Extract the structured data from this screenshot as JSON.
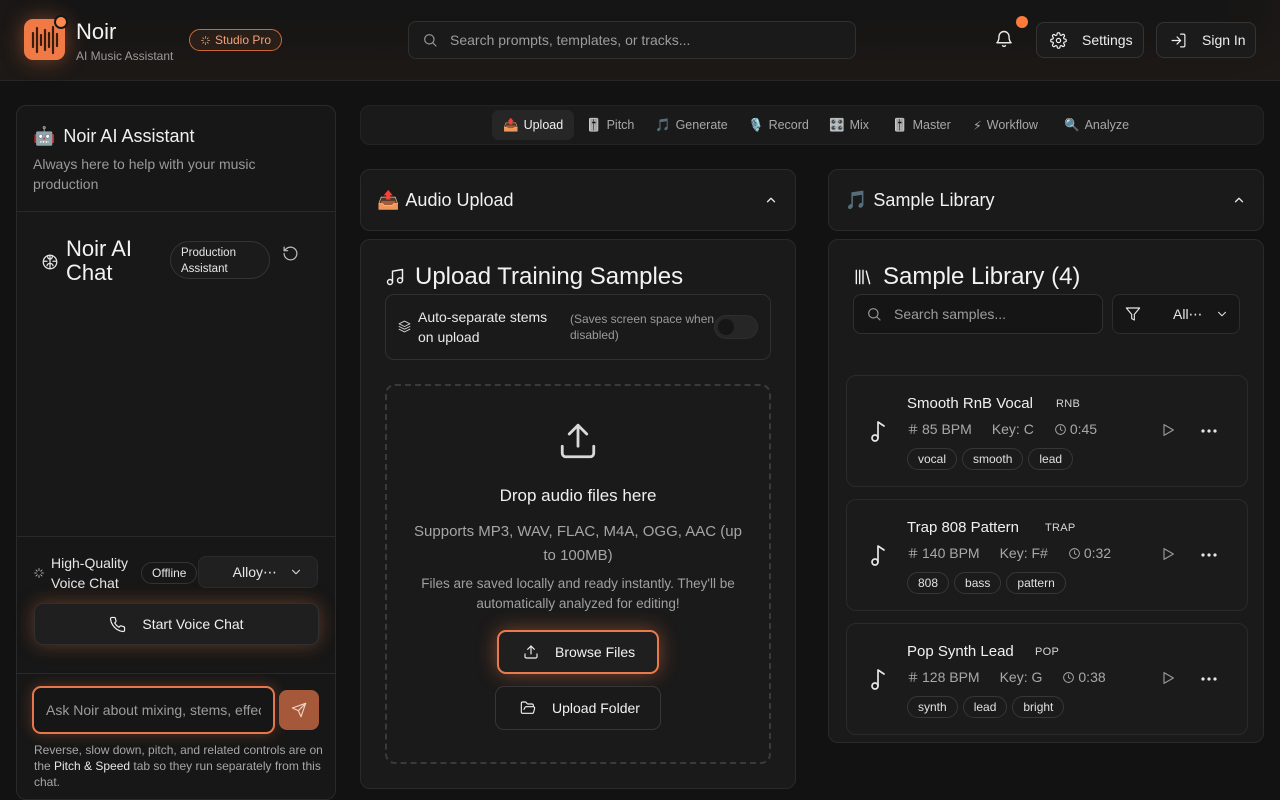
{
  "header": {
    "brand_name": "Noir",
    "brand_sub": "AI Music Assistant",
    "studio_badge": "Studio Pro",
    "search_placeholder": "Search prompts, templates, or tracks...",
    "settings_label": "Settings",
    "signin_label": "Sign In"
  },
  "sidebar": {
    "assistant_title": "Noir AI Assistant",
    "assistant_subtitle": "Always here to help with your music production",
    "chat_title": "Noir AI Chat",
    "production_badge": "Production Assistant",
    "voice": {
      "label": "High-Quality Voice Chat",
      "status": "Offline",
      "selected_voice": "Alloy⋯",
      "start_label": "Start Voice Chat"
    },
    "input_placeholder": "Ask Noir about mixing, stems, effects...",
    "hint_pre": "Reverse, slow down, pitch, and related controls are on the ",
    "hint_bold": "Pitch & Speed",
    "hint_post": " tab so they run separately from this chat."
  },
  "tabs": [
    {
      "emoji": "📤",
      "label": "Upload",
      "active": true
    },
    {
      "emoji": "🎚️",
      "label": "Pitch"
    },
    {
      "emoji": "🎵",
      "label": "Generate"
    },
    {
      "emoji": "🎙️",
      "label": "Record"
    },
    {
      "emoji": "🎛️",
      "label": "Mix"
    },
    {
      "emoji": "🎚️",
      "label": "Master"
    },
    {
      "emoji": "⚡",
      "label": "Workflow"
    },
    {
      "emoji": "🔍",
      "label": "Analyze"
    }
  ],
  "upload": {
    "section_emoji": "📤",
    "section_title": "Audio Upload",
    "card_title": "Upload Training Samples",
    "auto_sep_label": "Auto-separate stems on upload",
    "auto_sep_note": "(Saves screen space when disabled)",
    "drop_title": "Drop audio files here",
    "drop_formats": "Supports MP3, WAV, FLAC, M4A, OGG, AAC (up to 100MB)",
    "drop_note": "Files are saved locally and ready instantly. They'll be automatically analyzed for editing!",
    "browse_label": "Browse Files",
    "folder_label": "Upload Folder"
  },
  "library": {
    "section_emoji": "🎵",
    "section_title": "Sample Library",
    "card_title": "Sample Library (4)",
    "search_placeholder": "Search samples...",
    "filter_value": "All⋯",
    "samples": [
      {
        "name": "Smooth RnB Vocal",
        "genre": "RNB",
        "bpm": "85 BPM",
        "key": "Key: C",
        "duration": "0:45",
        "tags": [
          "vocal",
          "smooth",
          "lead"
        ]
      },
      {
        "name": "Trap 808 Pattern",
        "genre": "TRAP",
        "bpm": "140 BPM",
        "key": "Key: F#",
        "duration": "0:32",
        "tags": [
          "808",
          "bass",
          "pattern"
        ]
      },
      {
        "name": "Pop Synth Lead",
        "genre": "POP",
        "bpm": "128 BPM",
        "key": "Key: G",
        "duration": "0:38",
        "tags": [
          "synth",
          "lead",
          "bright"
        ]
      }
    ]
  },
  "colors": {
    "accent": "#ef7a45",
    "background": "#121212",
    "panel": "#1a1a1a"
  }
}
